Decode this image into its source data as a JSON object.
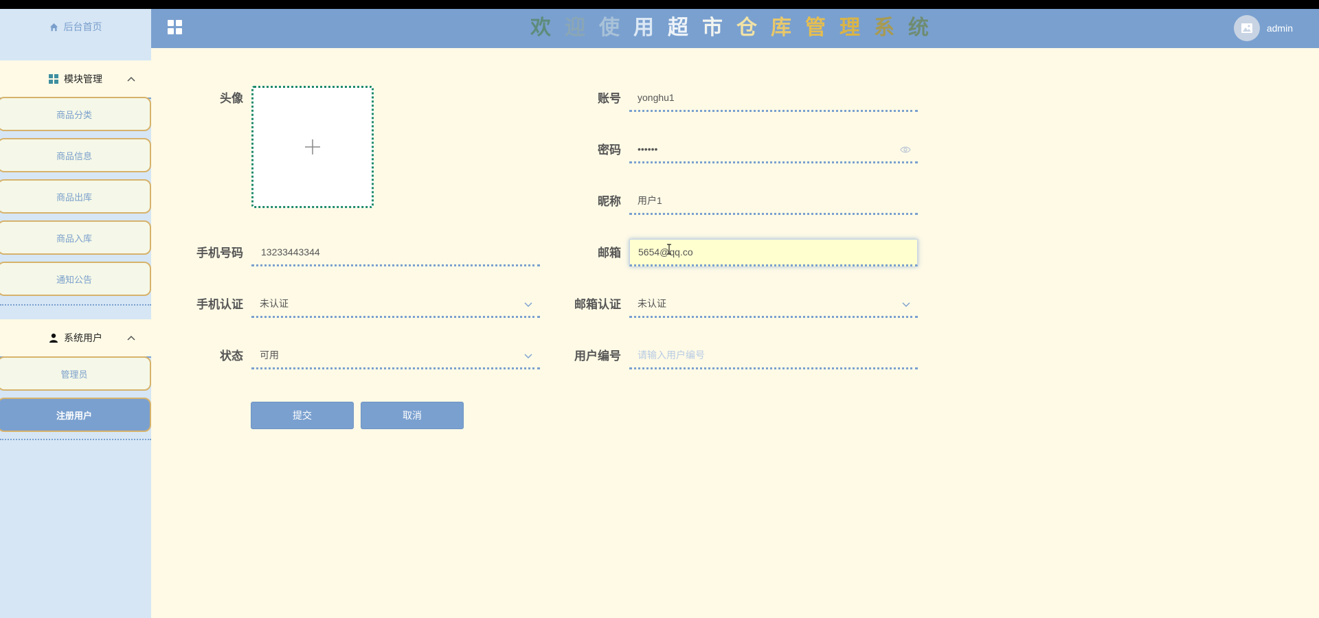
{
  "header": {
    "title_chars": [
      {
        "char": "欢",
        "color": "#5e8c7c"
      },
      {
        "char": "迎",
        "color": "#8aa6b6"
      },
      {
        "char": "使",
        "color": "#a9c2d8"
      },
      {
        "char": "用",
        "color": "#dce8f4"
      },
      {
        "char": "超",
        "color": "#eef3f8"
      },
      {
        "char": "市",
        "color": "#f2f4f0"
      },
      {
        "char": "仓",
        "color": "#f0e2a6"
      },
      {
        "char": "库",
        "color": "#e9c86a"
      },
      {
        "char": "管",
        "color": "#e6be4f"
      },
      {
        "char": "理",
        "color": "#d9b446"
      },
      {
        "char": "系",
        "color": "#a89a50"
      },
      {
        "char": "统",
        "color": "#6f8c72"
      }
    ],
    "username": "admin"
  },
  "sidebar": {
    "home_label": "后台首页",
    "groups": [
      {
        "label": "模块管理",
        "items": [
          "商品分类",
          "商品信息",
          "商品出库",
          "商品入库",
          "通知公告"
        ]
      },
      {
        "label": "系统用户",
        "items": [
          "管理员",
          "注册用户"
        ]
      }
    ]
  },
  "form": {
    "avatar_label": "头像",
    "account_label": "账号",
    "account_value": "yonghu1",
    "password_label": "密码",
    "password_value": "••••••",
    "nickname_label": "昵称",
    "nickname_value": "用户1",
    "phone_label": "手机号码",
    "phone_value": "13233443344",
    "email_label": "邮箱",
    "email_value": "5654@qq.co",
    "phone_verify_label": "手机认证",
    "phone_verify_value": "未认证",
    "email_verify_label": "邮箱认证",
    "email_verify_value": "未认证",
    "status_label": "状态",
    "status_value": "可用",
    "user_no_label": "用户编号",
    "user_no_placeholder": "请输入用户编号",
    "submit_label": "提交",
    "cancel_label": "取消"
  },
  "colors": {
    "accent": "#7aa0cf",
    "background": "#fefae6",
    "sidebar": "#d6e6f5",
    "nav_border": "#d7b26b"
  }
}
